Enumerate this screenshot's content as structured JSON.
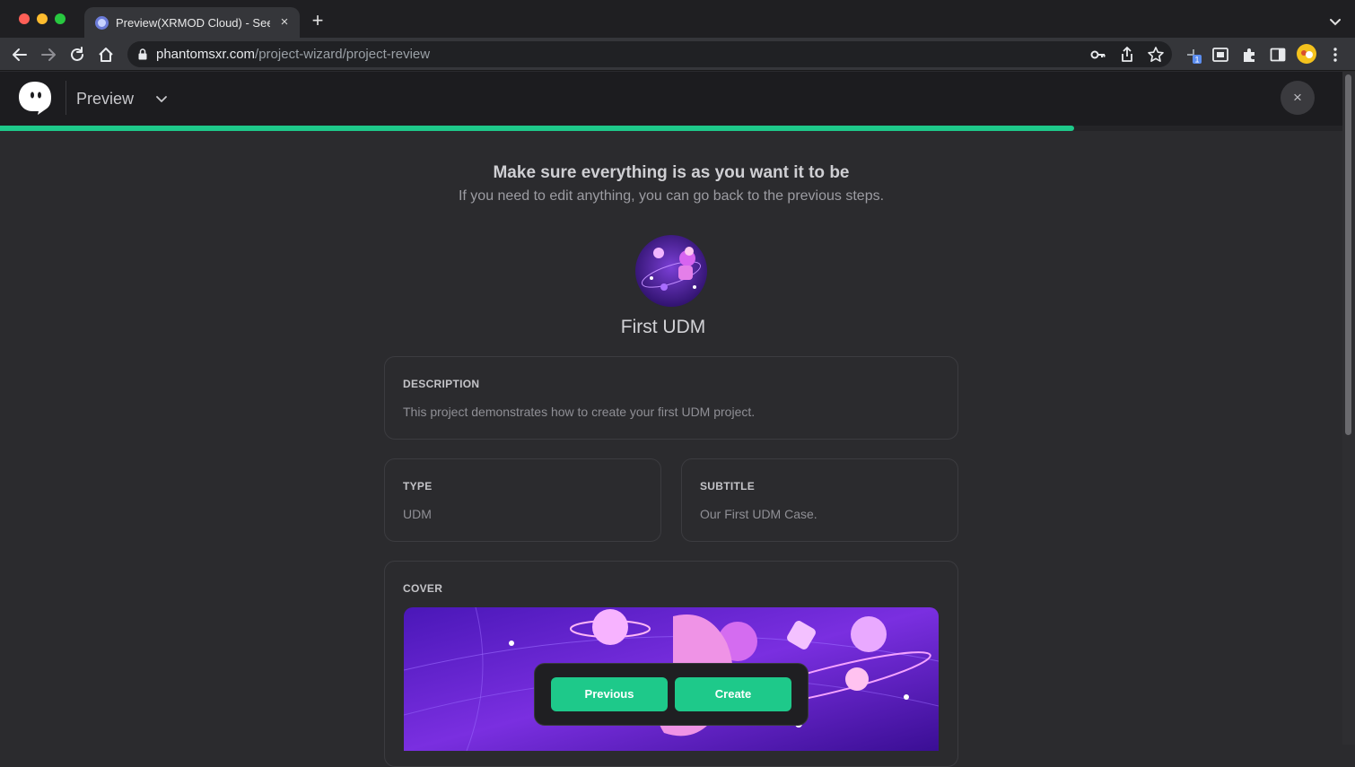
{
  "browser": {
    "tab_title": "Preview(XRMOD Cloud) - See Immersive",
    "tab_close": "×",
    "new_tab": "+",
    "url_host": "phantomsxr.com",
    "url_path": "/project-wizard/project-review",
    "extension_badge": "1",
    "colors": {
      "close": "#ff5f57",
      "minimize": "#febc2e",
      "maximize": "#28c840"
    }
  },
  "header": {
    "title": "Preview",
    "close_symbol": "×",
    "progress": 0.8
  },
  "review": {
    "heading": "Make sure everything is as you want it to be",
    "subheading": "If you need to edit anything, you can go back to the previous steps.",
    "project_name": "First UDM"
  },
  "fields": {
    "description": {
      "label": "DESCRIPTION",
      "value": "This project demonstrates how to create your first UDM project."
    },
    "type": {
      "label": "TYPE",
      "value": "UDM"
    },
    "subtitle": {
      "label": "SUBTITLE",
      "value": "Our First UDM Case."
    },
    "cover": {
      "label": "COVER"
    }
  },
  "actions": {
    "previous": "Previous",
    "create": "Create"
  },
  "theme": {
    "accent": "#1ec98a",
    "background": "#2b2b2e"
  }
}
